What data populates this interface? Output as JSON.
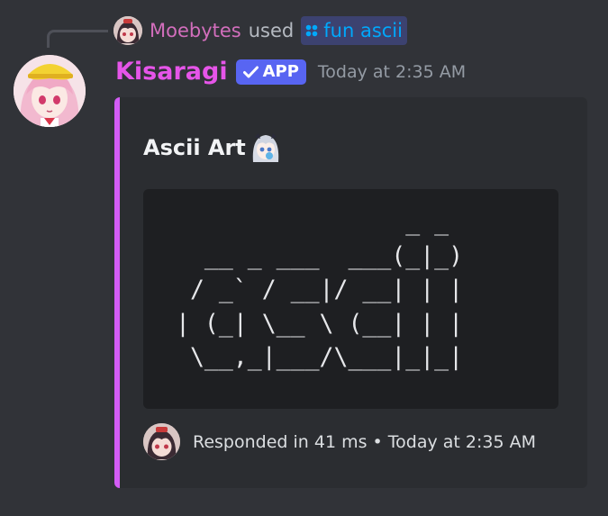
{
  "reply": {
    "username": "Moebytes",
    "used_text": "used",
    "command_icon": "slash-command-icon",
    "command_name": "fun ascii"
  },
  "message": {
    "username": "Kisaragi",
    "badge_label": "APP",
    "badge_icon": "checkmark-icon",
    "timestamp": "Today at 2:35 AM"
  },
  "embed": {
    "accent_color": "#d35cf5",
    "title": "Ascii Art",
    "ascii_art": "                _ _ \n  __ _ ___  ___(_|_)\n / _` / __|/ __| | |\n| (_| \\__ \\ (__| | |\n \\__,_|___/\\___|_|_|",
    "footer_text": "Responded in 41 ms • Today at 2:35 AM"
  },
  "colors": {
    "background": "#313338",
    "embed_background": "#2b2d31",
    "code_background": "#1e1f22",
    "username": "#e655e9",
    "reply_username": "#d26ebc",
    "app_badge": "#5865f2",
    "command_text": "#00a8fc"
  }
}
